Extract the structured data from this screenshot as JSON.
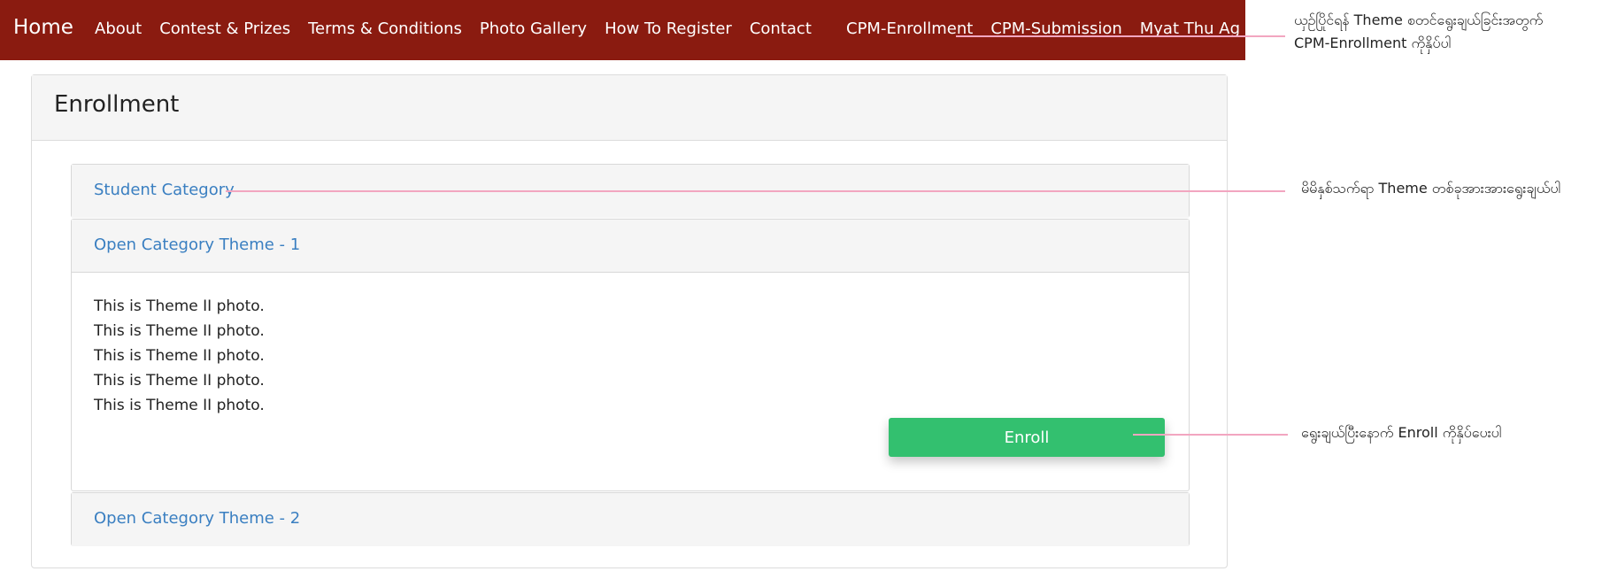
{
  "nav": {
    "brand": "Home",
    "left_links": [
      "About",
      "Contest & Prizes",
      "Terms & Conditions",
      "Photo Gallery",
      "How To Register",
      "Contact"
    ],
    "right_links": [
      "CPM-Enrollment",
      "CPM-Submission"
    ],
    "user": "Myat Thu Ag"
  },
  "page": {
    "title": "Enrollment"
  },
  "accordion": {
    "student": "Student Category",
    "theme1": "Open Category Theme - 1",
    "theme1_lines": [
      "This is Theme II photo.",
      "This is Theme II photo.",
      "This is Theme II photo.",
      "This is Theme II photo.",
      "This is Theme II photo."
    ],
    "theme2": "Open Category Theme - 2",
    "enroll_label": "Enroll"
  },
  "annotations": {
    "note1": [
      "ယှဉ်ပြိုင်ရန် Theme စတင်ရွေးချယ်ခြင်းအတွက်",
      "CPM-Enrollment ကိုနှိပ်ပါ"
    ],
    "note2": "မိမိနှစ်သက်ရာ Theme တစ်ခုအားအားရွေးချယ်ပါ",
    "note3": "ရွေးချယ်ပြီးနောက် Enroll ကိုနှိပ်ပေးပါ"
  },
  "colors": {
    "navbar": "#8a1b10",
    "link": "#3a7fc1",
    "enroll_button": "#33c06f",
    "callout": "#f2a6c0"
  }
}
